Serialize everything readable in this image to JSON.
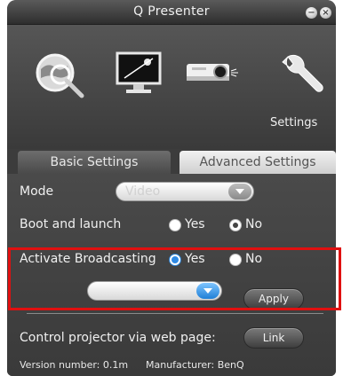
{
  "window": {
    "title": "Q Presenter",
    "minimize_icon": "minimize-icon",
    "close_icon": "close-icon"
  },
  "toolbar": {
    "items": [
      {
        "icon": "globe-search-icon"
      },
      {
        "icon": "monitor-icon"
      },
      {
        "icon": "projector-icon"
      },
      {
        "icon": "wrench-icon",
        "label": "Settings"
      }
    ]
  },
  "tabs": [
    {
      "label": "Basic Settings"
    },
    {
      "label": "Advanced Settings"
    }
  ],
  "settings": {
    "mode_label": "Mode",
    "mode_value": "Video",
    "boot_label": "Boot and launch",
    "boot_yes": "Yes",
    "boot_no": "No",
    "boot_selected": "No",
    "broadcast_label": "Activate Broadcasting",
    "broadcast_yes": "Yes",
    "broadcast_no": "No",
    "broadcast_selected": "Yes",
    "broadcast_select_value": "",
    "apply_label": "Apply",
    "control_label": "Control projector via web page:",
    "link_label": "Link"
  },
  "footer": {
    "version_text": "Version number: 0.1m",
    "manufacturer_text": "Manufacturer: BenQ"
  },
  "colors": {
    "highlight": "#e01010",
    "accent_blue": "#2e8ae6",
    "window_bg": "#3f3f3f"
  }
}
